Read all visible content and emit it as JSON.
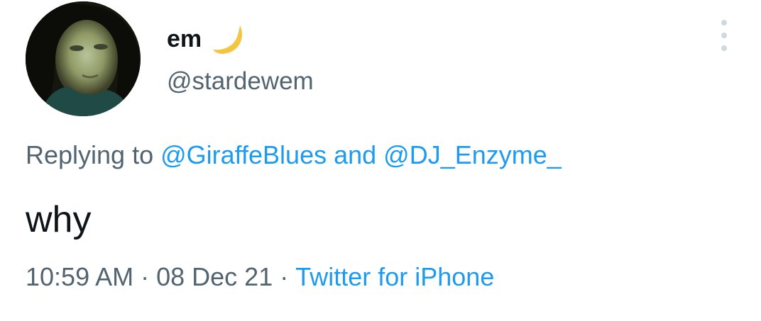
{
  "author": {
    "display_name": "em",
    "handle": "@stardewem",
    "name_emoji_icon": "crescent-moon-icon",
    "avatar_icon": "profile-photo"
  },
  "reply": {
    "prefix": "Replying to ",
    "mention_1": "@GiraffeBlues",
    "conjunction": " and ",
    "mention_2": "@DJ_Enzyme_"
  },
  "tweet": {
    "text": "why"
  },
  "meta": {
    "time": "10:59 AM",
    "separator": "·",
    "date": "08 Dec 21",
    "source": "Twitter for iPhone"
  },
  "menu": {
    "icon": "more-vertical-icon"
  },
  "colors": {
    "link": "#1d9bf0",
    "secondary_text": "#536471",
    "primary_text": "#0f1419",
    "moon": "#f5c542"
  }
}
